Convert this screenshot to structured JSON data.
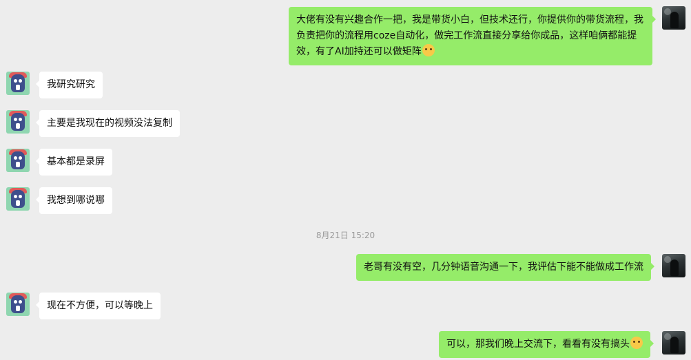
{
  "messages": [
    {
      "side": "right",
      "text": "大佬有没有兴趣合作一把，我是带货小白，但技术还行，你提供你的带货流程，我负责把你的流程用coze自动化，做完工作流直接分享给你成品，这样咱俩都能提效，有了AI加持还可以做矩阵",
      "emoji": "thinking-emoji"
    },
    {
      "side": "left",
      "text": "我研究研究"
    },
    {
      "side": "left",
      "text": "主要是我现在的视频没法复制"
    },
    {
      "side": "left",
      "text": "基本都是录屏"
    },
    {
      "side": "left",
      "text": "我想到哪说哪"
    },
    {
      "side": "right",
      "text": "老哥有没有空，几分钟语音沟通一下，我评估下能不能做成工作流"
    },
    {
      "side": "left",
      "text": "现在不方便，可以等晚上"
    },
    {
      "side": "right",
      "text": "可以，那我们晚上交流下，看看有没有搞头",
      "emoji": "thinking-emoji"
    }
  ],
  "timestamp": "8月21日 15:20",
  "colors": {
    "background": "#ededed",
    "sent_bubble": "#95ec69",
    "received_bubble": "#ffffff"
  }
}
